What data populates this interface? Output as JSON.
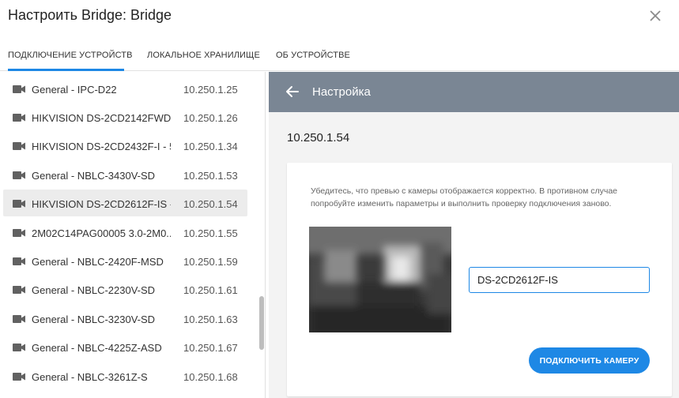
{
  "dialog": {
    "title": "Настроить Bridge: Bridge",
    "close_icon": "close-icon"
  },
  "tabs": [
    {
      "label": "ПОДКЛЮЧЕНИЕ УСТРОЙСТВ",
      "active": true
    },
    {
      "label": "ЛОКАЛЬНОЕ ХРАНИЛИЩЕ",
      "active": false
    },
    {
      "label": "ОБ УСТРОЙСТВЕ",
      "active": false
    }
  ],
  "devices": [
    {
      "name": "General - IPC-D22",
      "ip": "10.250.1.25"
    },
    {
      "name": "HIKVISION DS-2CD2142FWD-...",
      "ip": "10.250.1.26"
    },
    {
      "name": "HIKVISION DS-2CD2432F-I - 5...",
      "ip": "10.250.1.34"
    },
    {
      "name": "General - NBLC-3430V-SD",
      "ip": "10.250.1.53"
    },
    {
      "name": "HIKVISION DS-2CD2612F-IS - ...",
      "ip": "10.250.1.54",
      "selected": true
    },
    {
      "name": "2M02C14PAG00005 3.0-2M0...",
      "ip": "10.250.1.55"
    },
    {
      "name": "General - NBLC-2420F-MSD",
      "ip": "10.250.1.59"
    },
    {
      "name": "General - NBLC-2230V-SD",
      "ip": "10.250.1.61"
    },
    {
      "name": "General - NBLC-3230V-SD",
      "ip": "10.250.1.63"
    },
    {
      "name": "General - NBLC-4225Z-ASD",
      "ip": "10.250.1.67"
    },
    {
      "name": "General - NBLC-3261Z-S",
      "ip": "10.250.1.68"
    }
  ],
  "settings": {
    "title": "Настройка",
    "back_icon": "arrow-left-icon",
    "device_ip": "10.250.1.54",
    "hint": "Убедитесь, что превью с камеры отображается корректно. В противном случае попробуйте изменить параметры и выполнить проверку подключения заново.",
    "camera_name": "DS-2CD2612F-IS",
    "connect_label": "ПОДКЛЮЧИТЬ КАМЕРУ"
  },
  "colors": {
    "accent": "#1e88e5",
    "bar": "#7a8694",
    "selected_row": "#ececec"
  }
}
